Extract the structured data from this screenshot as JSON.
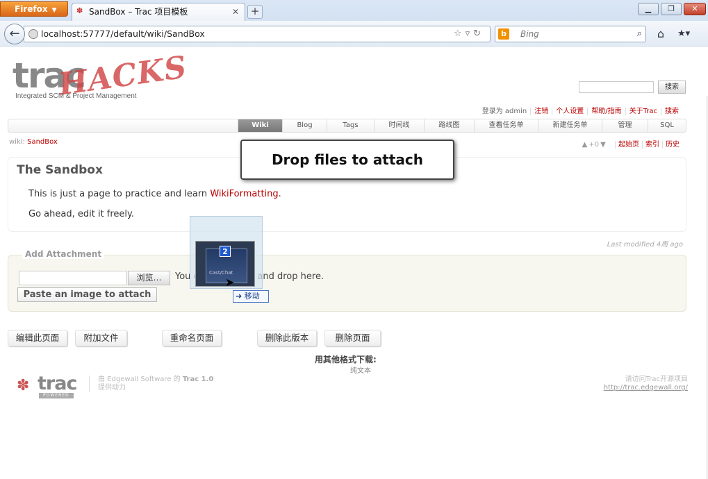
{
  "browser": {
    "menu_label": "Firefox",
    "tab_title": "SandBox – Trac 项目模板",
    "new_tab": "+",
    "url": "localhost:57777/default/wiki/SandBox",
    "search_placeholder": "Bing"
  },
  "site": {
    "logo_text": "trac",
    "logo_overlay": "HACKS",
    "logo_sub": "Integrated SCM & Project Management",
    "search_button": "搜索"
  },
  "meta_nav": [
    "登录为 admin",
    "注销",
    "个人设置",
    "帮助/指南",
    "关于Trac",
    "搜索"
  ],
  "main_nav": [
    "Wiki",
    "Blog",
    "Tags",
    "时间线",
    "路线图",
    "查看任务单",
    "新建任务单",
    "管理",
    "SQL"
  ],
  "breadcrumb": {
    "prefix": "wiki:",
    "page": "SandBox"
  },
  "context_nav": {
    "votes": "+0",
    "items": [
      "起始页",
      "索引",
      "历史"
    ]
  },
  "wiki": {
    "title": "The Sandbox",
    "line1_text": "This is just a page to practice and learn ",
    "line1_link": "WikiFormatting",
    "line1_end": ".",
    "line2": "Go ahead, edit it freely."
  },
  "last_modified": "Last modified 4周 ago",
  "attachment": {
    "legend": "Add Attachment",
    "browse_button": "浏览…",
    "hint": "You can also drag and drop here.",
    "paste_button": "Paste an image to attach"
  },
  "actions": [
    "编辑此页面",
    "附加文件",
    "重命名页面",
    "删除此版本",
    "删除页面"
  ],
  "download": {
    "title": "用其他格式下载:",
    "format": "纯文本"
  },
  "footer": {
    "logo": "trac",
    "powered": "POWERED",
    "by_prefix": "由 Edgewall Software 的 ",
    "by_version": "Trac 1.0",
    "by_suffix": "提供动力",
    "visit": "请访问Trac开源项目",
    "visit_link": "http://trac.edgewall.org/"
  },
  "overlay": {
    "drop_text": "Drop files to attach",
    "drag_count": "2",
    "move_label": "移动",
    "thumb_label": "Cast/Chat"
  }
}
